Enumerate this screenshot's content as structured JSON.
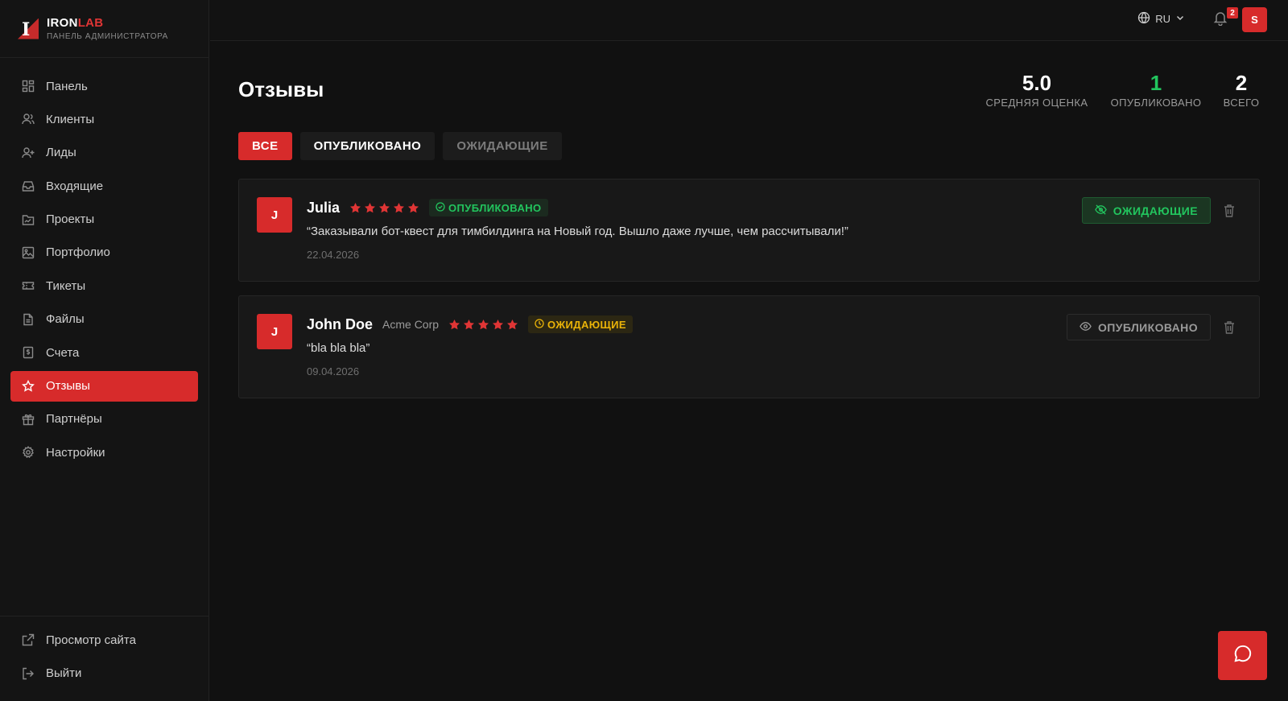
{
  "brand": {
    "name_main": "IRON",
    "name_accent": "LAB",
    "subtitle": "ПАНЕЛЬ АДМИНИСТРАТОРА"
  },
  "sidebar": {
    "items": [
      {
        "label": "Панель",
        "icon": "dashboard-icon"
      },
      {
        "label": "Клиенты",
        "icon": "users-icon"
      },
      {
        "label": "Лиды",
        "icon": "user-plus-icon"
      },
      {
        "label": "Входящие",
        "icon": "inbox-icon"
      },
      {
        "label": "Проекты",
        "icon": "folder-icon"
      },
      {
        "label": "Портфолио",
        "icon": "image-icon"
      },
      {
        "label": "Тикеты",
        "icon": "ticket-icon"
      },
      {
        "label": "Файлы",
        "icon": "file-icon"
      },
      {
        "label": "Счета",
        "icon": "invoice-icon"
      },
      {
        "label": "Отзывы",
        "icon": "star-icon",
        "active": true
      },
      {
        "label": "Партнёры",
        "icon": "gift-icon"
      },
      {
        "label": "Настройки",
        "icon": "gear-icon"
      }
    ],
    "bottom": [
      {
        "label": "Просмотр сайта",
        "icon": "external-link-icon"
      },
      {
        "label": "Выйти",
        "icon": "logout-icon"
      }
    ]
  },
  "topbar": {
    "language": "RU",
    "notifications_count": "2",
    "user_initial": "S"
  },
  "page": {
    "title": "Отзывы"
  },
  "stats": [
    {
      "value": "5.0",
      "label": "СРЕДНЯЯ ОЦЕНКА"
    },
    {
      "value": "1",
      "label": "ОПУБЛИКОВАНО"
    },
    {
      "value": "2",
      "label": "ВСЕГО"
    }
  ],
  "tabs": [
    {
      "label": "ВСЕ",
      "active": true
    },
    {
      "label": "ОПУБЛИКОВАНО"
    },
    {
      "label": "ОЖИДАЮЩИЕ"
    }
  ],
  "reviews": [
    {
      "initial": "J",
      "name": "Julia",
      "company": "",
      "rating": 5,
      "status": "ОПУБЛИКОВАНО",
      "text": "“Заказывали бот-квест для тимбилдинга на Новый год. Вышло даже лучше, чем рассчитывали!”",
      "date": "22.04.2026",
      "action_label": "ОЖИДАЮЩИЕ"
    },
    {
      "initial": "J",
      "name": "John Doe",
      "company": "Acme Corp",
      "rating": 5,
      "status": "ОЖИДАЮЩИЕ",
      "text": "“bla bla bla”",
      "date": "09.04.2026",
      "action_label": "ОПУБЛИКОВАНО"
    }
  ],
  "colors": {
    "accent": "#d72b2b",
    "published": "#22c55e",
    "pending": "#eab308",
    "background": "#111111"
  }
}
